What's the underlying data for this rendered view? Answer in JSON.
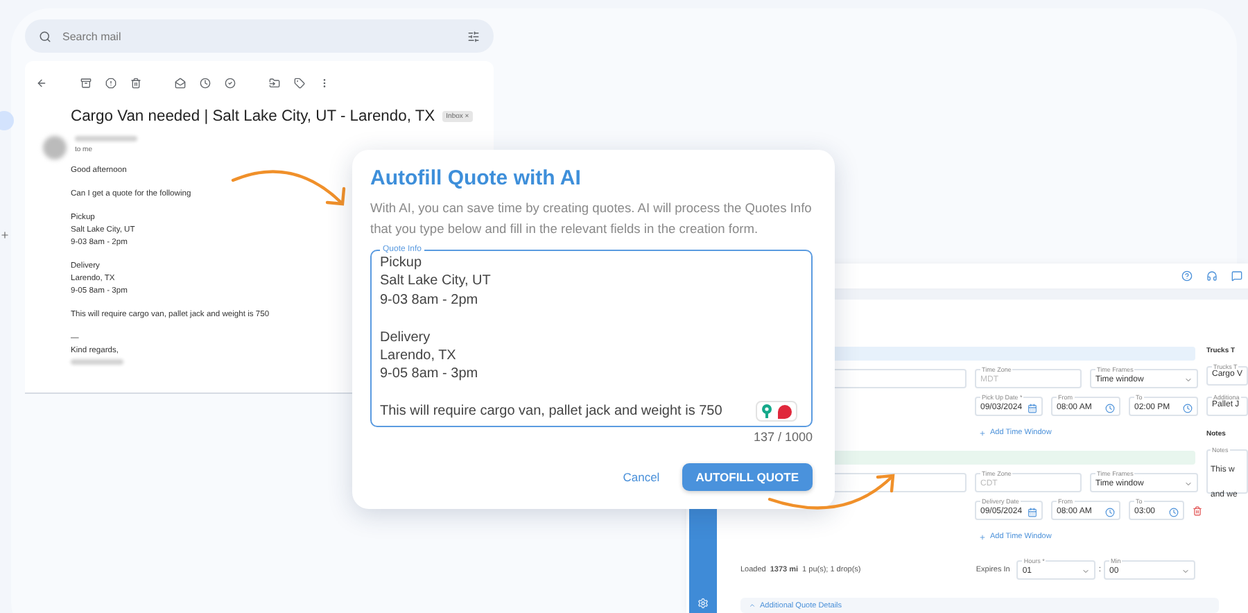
{
  "email": {
    "search": {
      "placeholder": "Search mail"
    },
    "subject": "Cargo Van needed | Salt Lake City, UT - Larendo, TX",
    "chip": {
      "label": "Inbox",
      "close": "×"
    },
    "recipient": "to me",
    "paragraphs": [
      "Good afternoon",
      "Can I get a quote for the following",
      "Pickup\nSalt Lake City, UT\n9-03 8am - 2pm",
      "Delivery\nLarendo, TX\n9-05 8am - 3pm",
      "This will require cargo van, pallet jack and weight is 750",
      "—\nKind regards,"
    ]
  },
  "dialog": {
    "title": "Autofill Quote with AI",
    "description": "With AI, you can save time by creating quotes. AI will process the Quotes Info that you type below and fill in the relevant fields in the creation form.",
    "field": {
      "label": "Quote Info",
      "value": "Pickup\nSalt Lake City, UT\n9-03 8am - 2pm\n\nDelivery\nLarendo, TX\n9-05 8am - 3pm\n\nThis will require cargo van, pallet jack and weight is 750"
    },
    "counter": "137 / 1000",
    "buttons": [
      {
        "label": "Cancel",
        "kind": "text"
      },
      {
        "label": "AUTOFILL QUOTE",
        "kind": "primary"
      }
    ]
  },
  "quote_form": {
    "stops": [
      {
        "color": "#e7f1fb",
        "time_zone": {
          "label": "Time Zone",
          "value": "MDT"
        },
        "time_frames": {
          "label": "Time Frames",
          "value": "Time window"
        },
        "date": {
          "label": "Pick Up Date *",
          "value": "09/03/2024"
        },
        "from": {
          "label": "From",
          "value": "08:00 AM"
        },
        "to": {
          "label": "To",
          "value": "02:00 PM"
        },
        "deletable": false,
        "add_link": "Add Time Window"
      },
      {
        "color": "#e8f6ee",
        "time_zone": {
          "label": "Time Zone",
          "value": "CDT"
        },
        "time_frames": {
          "label": "Time Frames",
          "value": "Time window"
        },
        "date": {
          "label": "Delivery Date",
          "value": "09/05/2024"
        },
        "from": {
          "label": "From",
          "value": "08:00 AM"
        },
        "to": {
          "label": "To",
          "value": "03:00"
        },
        "deletable": true,
        "add_link": "Add Time Window"
      }
    ],
    "summary": {
      "label": "Loaded",
      "distance": "1373 mi",
      "counts": "1 pu(s); 1 drop(s)"
    },
    "expires": {
      "label": "Expires In",
      "hours": {
        "label": "Hours *",
        "value": "01"
      },
      "separator": ":",
      "minutes": {
        "label": "Min",
        "value": "00"
      }
    },
    "details_toggle": "Additional Quote Details",
    "side": {
      "trucks_title": "Trucks T",
      "fields": [
        {
          "label": "Trucks T",
          "value": "Cargo V"
        },
        {
          "label": "Additiona",
          "value": "Pallet J"
        }
      ],
      "notes_title": "Notes",
      "notes": {
        "label": "Notes",
        "value": "This w\nand we"
      }
    }
  }
}
